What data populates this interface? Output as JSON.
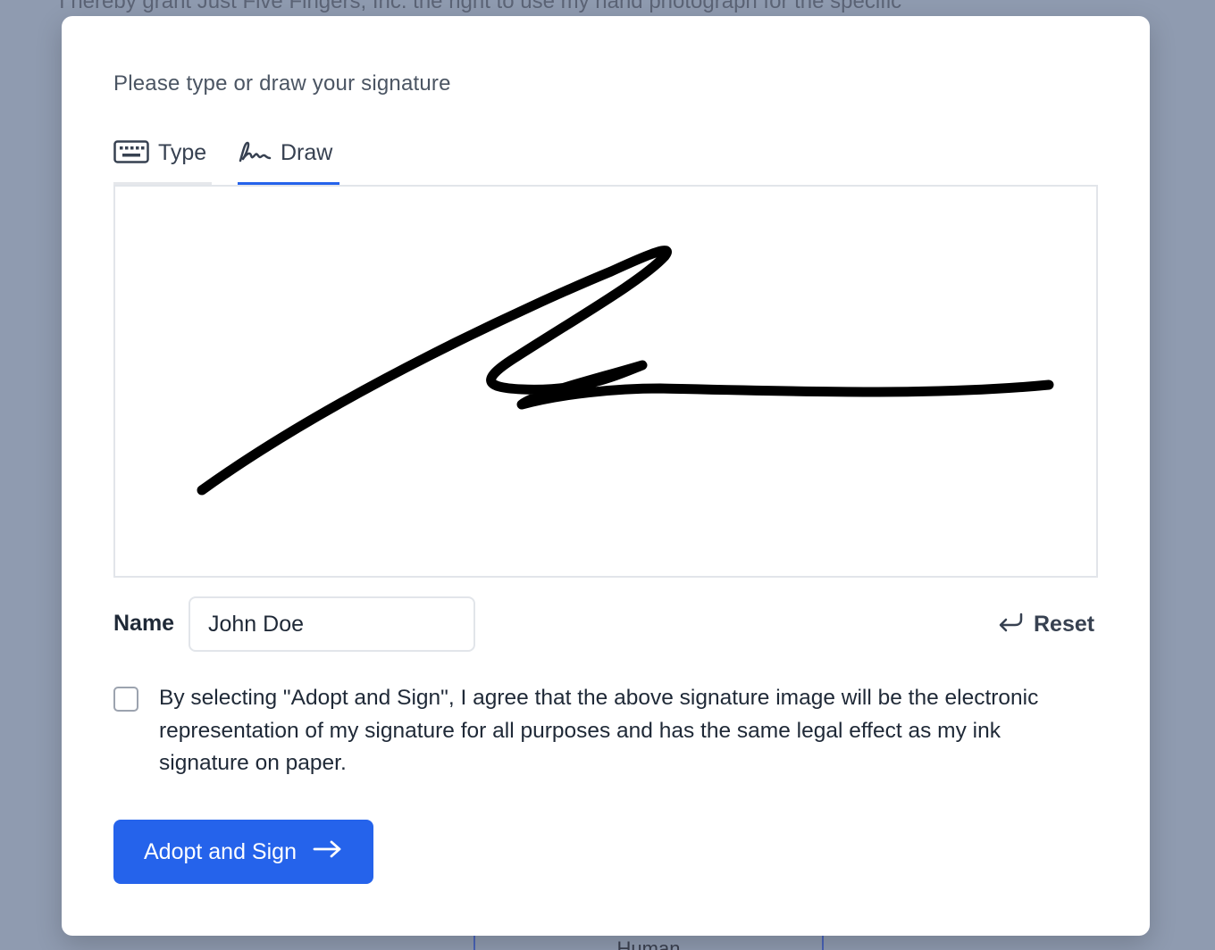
{
  "background": {
    "document_text": "I hereby grant Just Five Fingers, Inc. the right to use my hand photograph for the specific",
    "box_label": "Human"
  },
  "modal": {
    "instruction": "Please type or draw your signature",
    "tabs": [
      {
        "label": "Type",
        "icon": "keyboard-icon",
        "active": false
      },
      {
        "label": "Draw",
        "icon": "signature-pen-icon",
        "active": true
      }
    ],
    "name_label": "Name",
    "name_value": "John Doe",
    "reset_label": "Reset",
    "consent_checked": false,
    "consent_text": "By selecting \"Adopt and Sign\", I agree that the above signature image will be the electronic representation of my signature for all purposes and has the same legal effect as my ink signature on paper.",
    "adopt_label": "Adopt and Sign"
  },
  "colors": {
    "accent": "#2563eb",
    "overlay": "#8f9bb0"
  }
}
